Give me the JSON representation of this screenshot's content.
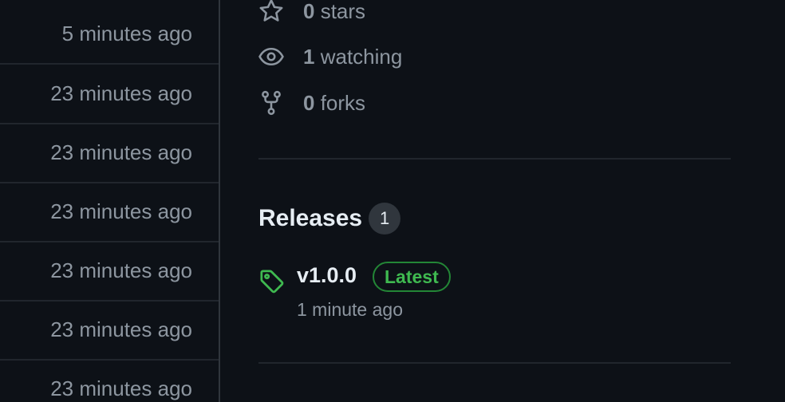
{
  "file_list": {
    "rows": [
      {
        "time": "5 minutes ago"
      },
      {
        "time": "23 minutes ago"
      },
      {
        "time": "23 minutes ago"
      },
      {
        "time": "23 minutes ago"
      },
      {
        "time": "23 minutes ago"
      },
      {
        "time": "23 minutes ago"
      },
      {
        "time": "23 minutes ago"
      }
    ]
  },
  "about": {
    "stars": {
      "icon": "star-icon",
      "count": "0",
      "label": "stars"
    },
    "watching": {
      "icon": "eye-icon",
      "count": "1",
      "label": "watching"
    },
    "forks": {
      "icon": "fork-icon",
      "count": "0",
      "label": "forks"
    }
  },
  "releases": {
    "title": "Releases",
    "count": "1",
    "items": [
      {
        "icon": "tag-icon",
        "name": "v1.0.0",
        "badge": "Latest",
        "time": "1 minute ago"
      }
    ]
  },
  "colors": {
    "background": "#0d1117",
    "border": "#30363d",
    "muted_text": "#8d96a0",
    "primary_text": "#e6edf3",
    "success": "#3fb950",
    "success_border": "#238636"
  }
}
